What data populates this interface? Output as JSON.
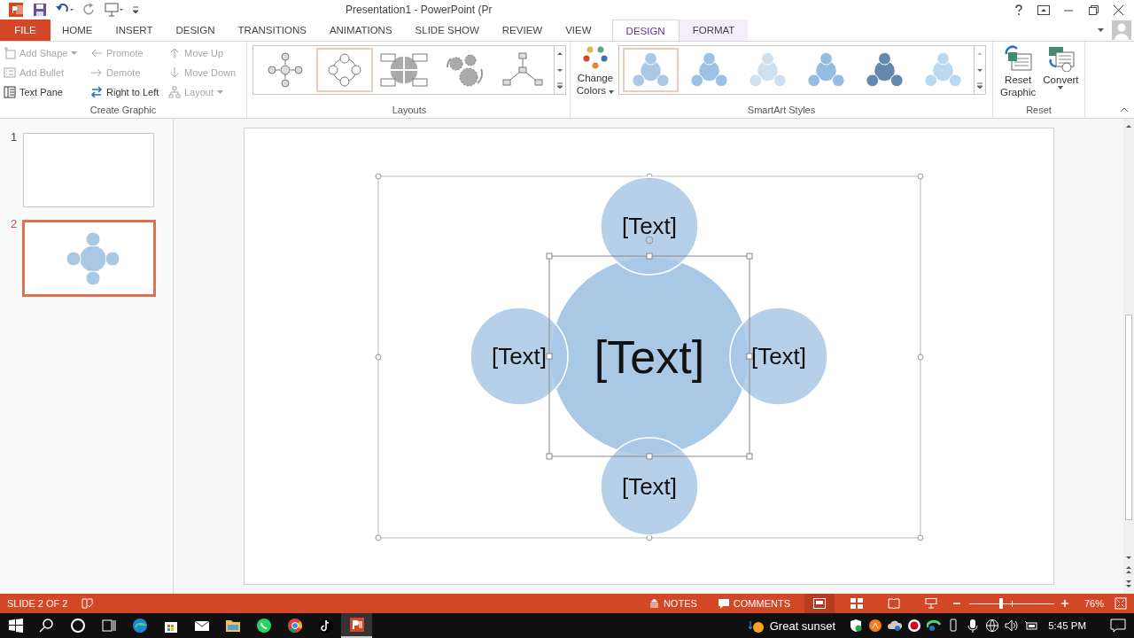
{
  "title_bar": {
    "title": "Presentation1 - PowerPoint (Pr"
  },
  "tabs": [
    {
      "label": "FILE",
      "kind": "file",
      "selected": false
    },
    {
      "label": "HOME",
      "kind": "main",
      "selected": false
    },
    {
      "label": "INSERT",
      "kind": "main",
      "selected": false
    },
    {
      "label": "DESIGN",
      "kind": "main",
      "selected": false
    },
    {
      "label": "TRANSITIONS",
      "kind": "main",
      "selected": false
    },
    {
      "label": "ANIMATIONS",
      "kind": "main",
      "selected": false
    },
    {
      "label": "SLIDE SHOW",
      "kind": "main",
      "selected": false
    },
    {
      "label": "REVIEW",
      "kind": "main",
      "selected": false
    },
    {
      "label": "VIEW",
      "kind": "main",
      "selected": false
    },
    {
      "label": "DESIGN",
      "kind": "contextual",
      "selected": true
    },
    {
      "label": "FORMAT",
      "kind": "contextual",
      "selected": false
    }
  ],
  "ribbon": {
    "create_graphic": {
      "label": "Create Graphic",
      "columns": [
        [
          {
            "label": "Add Shape",
            "disabled": true,
            "dropdown": true
          },
          {
            "label": "Add Bullet",
            "disabled": true,
            "dropdown": false
          },
          {
            "label": "Text Pane",
            "disabled": false,
            "dropdown": false
          }
        ],
        [
          {
            "label": "Promote",
            "disabled": true,
            "dropdown": false
          },
          {
            "label": "Demote",
            "disabled": true,
            "dropdown": false
          },
          {
            "label": "Right to Left",
            "disabled": false,
            "dropdown": false
          }
        ],
        [
          {
            "label": "Move Up",
            "disabled": true,
            "dropdown": false
          },
          {
            "label": "Move Down",
            "disabled": true,
            "dropdown": false
          },
          {
            "label": "Layout",
            "disabled": true,
            "dropdown": true
          }
        ]
      ]
    },
    "layouts": {
      "label": "Layouts",
      "items": [
        {
          "selected": false
        },
        {
          "selected": true
        },
        {
          "selected": false
        },
        {
          "selected": false
        },
        {
          "selected": false
        }
      ]
    },
    "smartart_styles": {
      "label": "SmartArt Styles",
      "change_colors": [
        "Change",
        "Colors"
      ],
      "items": [
        {
          "selected": true,
          "color": "#a9c8e6"
        },
        {
          "selected": false,
          "color": "#9dc1e4"
        },
        {
          "selected": false,
          "color": "#cfe0f1"
        },
        {
          "selected": false,
          "color": "#95bde3"
        },
        {
          "selected": false,
          "color": "#6489ad"
        },
        {
          "selected": false,
          "color": "#bcd8ef"
        }
      ]
    },
    "reset": {
      "label": "Reset",
      "buttons": [
        {
          "lines": [
            "Reset",
            "Graphic"
          ],
          "dropdown": false
        },
        {
          "lines": [
            "Convert"
          ],
          "dropdown": true
        }
      ]
    }
  },
  "slides": [
    {
      "number": "1",
      "selected": false,
      "kind": "blank"
    },
    {
      "number": "2",
      "selected": true,
      "kind": "smartart"
    }
  ],
  "smartart": {
    "nodes": [
      {
        "text": "[Text]",
        "kind": "top"
      },
      {
        "text": "[Text]",
        "kind": "left"
      },
      {
        "text": "[Text]",
        "kind": "center"
      },
      {
        "text": "[Text]",
        "kind": "right"
      },
      {
        "text": "[Text]",
        "kind": "bottom"
      }
    ]
  },
  "status_bar": {
    "slide": "SLIDE 2 OF 2",
    "notes": "NOTES",
    "comments": "COMMENTS",
    "zoom": {
      "level": 0.37,
      "reading": "76%"
    }
  },
  "taskbar": {
    "weather": "Great sunset",
    "time": "5:45 PM"
  }
}
